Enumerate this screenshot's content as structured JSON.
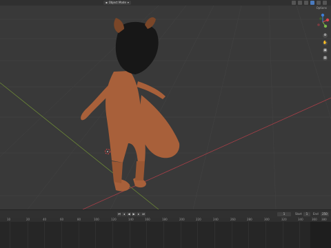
{
  "header": {
    "mode_label": "Object Mode",
    "mode_icon": "object-mode-icon",
    "options_label": "Options"
  },
  "gizmo": {
    "axes": [
      "X",
      "Y",
      "Z"
    ],
    "colors": {
      "x": "#e0404a",
      "y": "#7ab84a",
      "z": "#3d7fd6"
    }
  },
  "colors": {
    "fur": "#a8603a",
    "hair": "#161616",
    "grid": "#474747",
    "x_axis": "#b9434c",
    "y_axis": "#7a9a3a"
  },
  "timeline": {
    "current_frame": "1",
    "start_label": "Start",
    "start_value": "1",
    "end_label": "End",
    "end_value": "250",
    "ruler_ticks": [
      "10",
      "20",
      "40",
      "60",
      "80",
      "100",
      "120",
      "140",
      "160",
      "180",
      "200",
      "220",
      "240",
      "260",
      "280",
      "300",
      "320",
      "340",
      "360",
      "380"
    ]
  }
}
